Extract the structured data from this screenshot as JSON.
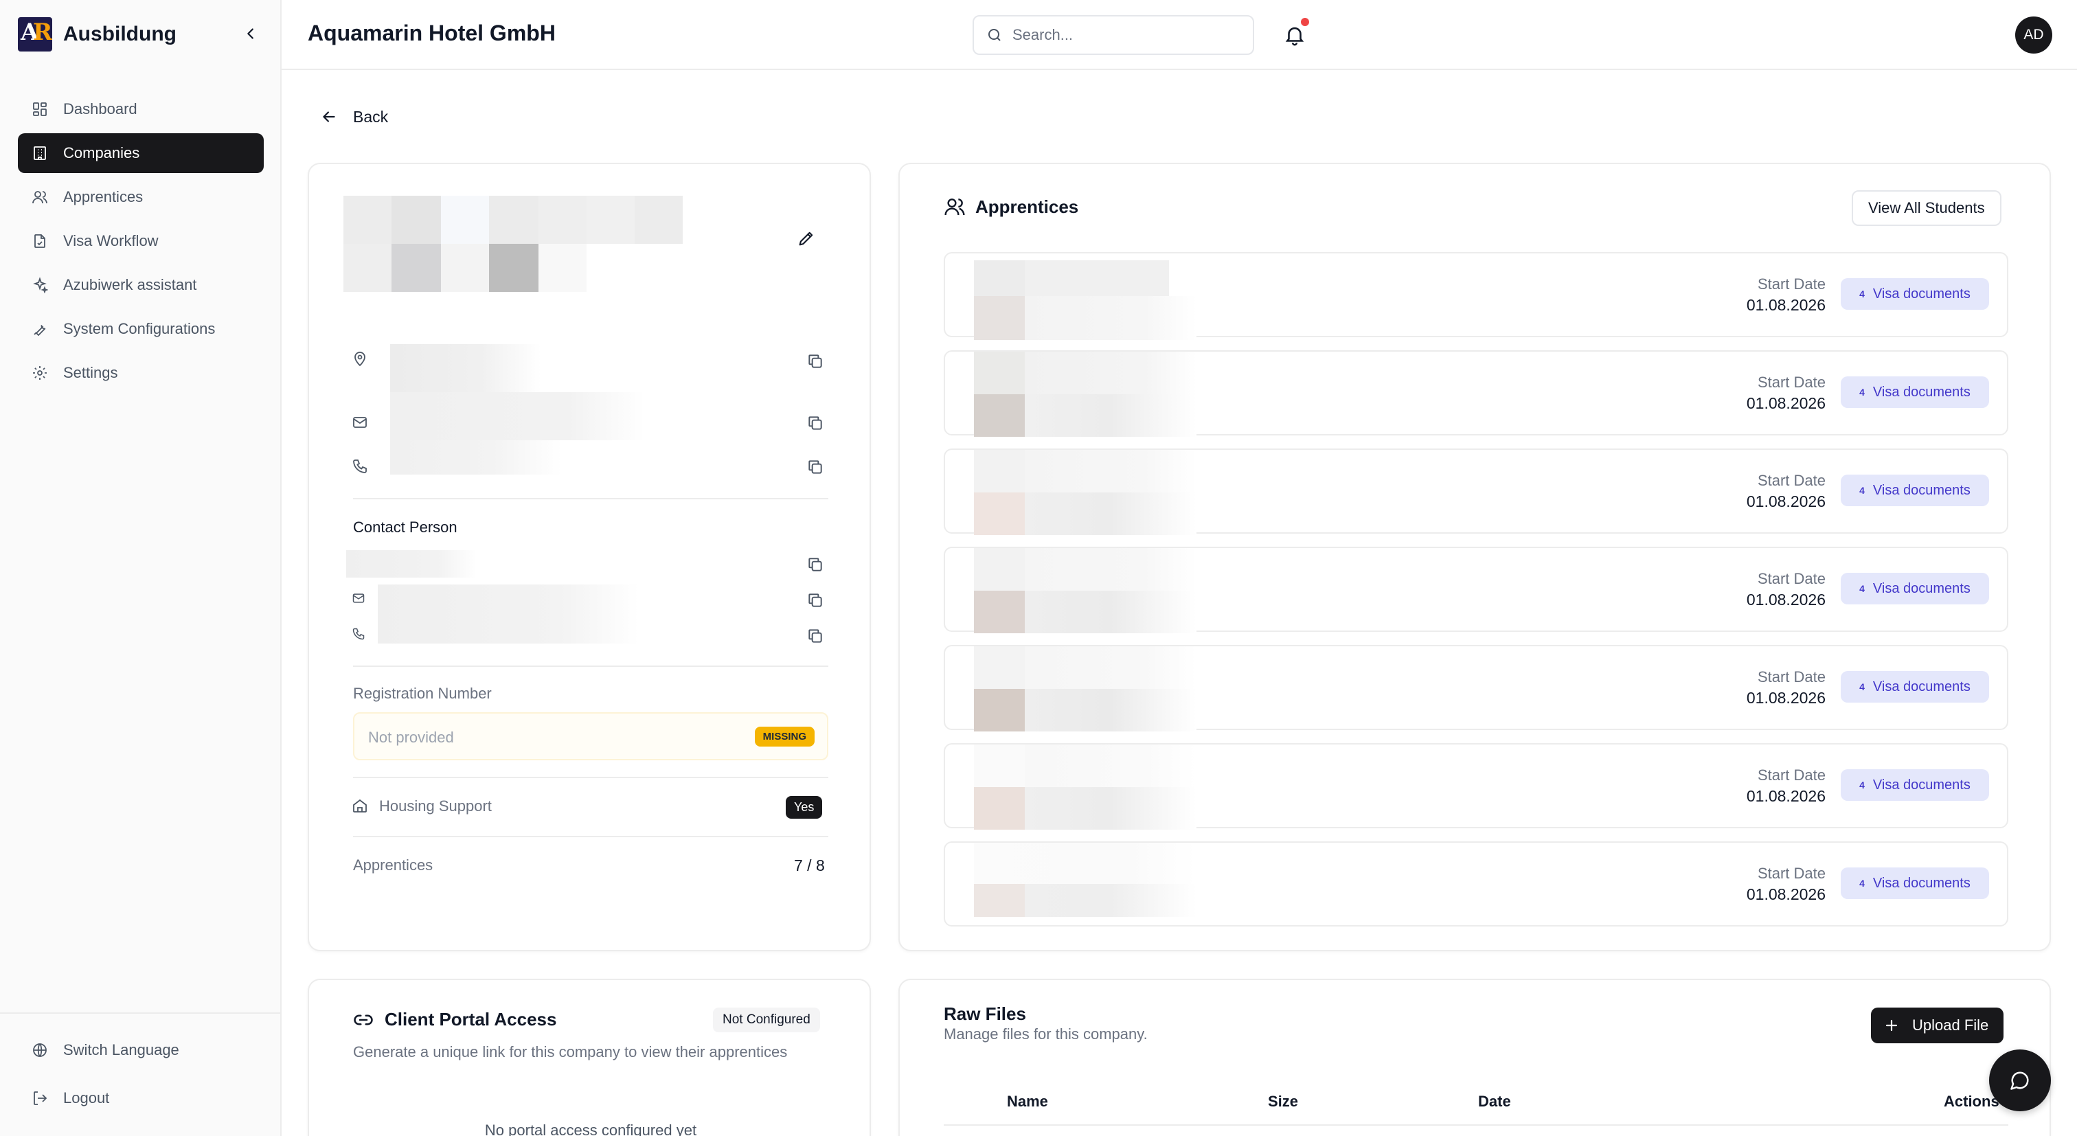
{
  "brand": {
    "title": "Ausbildung"
  },
  "sidebar": {
    "items": [
      {
        "label": "Dashboard",
        "icon": "dashboard-icon"
      },
      {
        "label": "Companies",
        "icon": "building-icon",
        "active": true
      },
      {
        "label": "Apprentices",
        "icon": "users-icon"
      },
      {
        "label": "Visa Workflow",
        "icon": "file-check-icon"
      },
      {
        "label": "Azubiwerk assistant",
        "icon": "sparkles-icon"
      },
      {
        "label": "System Configurations",
        "icon": "wrench-icon"
      },
      {
        "label": "Settings",
        "icon": "gear-icon"
      }
    ],
    "bottom": [
      {
        "label": "Switch Language",
        "icon": "globe-icon"
      },
      {
        "label": "Logout",
        "icon": "logout-icon"
      }
    ]
  },
  "header": {
    "title": "Aquamarin Hotel GmbH",
    "search_placeholder": "Search...",
    "avatar": "AD",
    "notification_color": "#ef4444"
  },
  "back_label": "Back",
  "company": {
    "contact_person_label": "Contact Person",
    "registration_label": "Registration Number",
    "registration_placeholder": "Not provided",
    "registration_status": "MISSING",
    "housing_label": "Housing Support",
    "housing_value": "Yes",
    "apprentices_label": "Apprentices",
    "apprentices_value": "7 / 8"
  },
  "apprentices": {
    "title": "Apprentices",
    "view_all_label": "View All Students",
    "rows": [
      {
        "start_label": "Start Date",
        "start_date": "01.08.2026",
        "visa_count": "4",
        "visa_label": "Visa documents"
      },
      {
        "start_label": "Start Date",
        "start_date": "01.08.2026",
        "visa_count": "4",
        "visa_label": "Visa documents"
      },
      {
        "start_label": "Start Date",
        "start_date": "01.08.2026",
        "visa_count": "4",
        "visa_label": "Visa documents"
      },
      {
        "start_label": "Start Date",
        "start_date": "01.08.2026",
        "visa_count": "4",
        "visa_label": "Visa documents"
      },
      {
        "start_label": "Start Date",
        "start_date": "01.08.2026",
        "visa_count": "4",
        "visa_label": "Visa documents"
      },
      {
        "start_label": "Start Date",
        "start_date": "01.08.2026",
        "visa_count": "4",
        "visa_label": "Visa documents"
      },
      {
        "start_label": "Start Date",
        "start_date": "01.08.2026",
        "visa_count": "4",
        "visa_label": "Visa documents"
      }
    ]
  },
  "portal": {
    "title": "Client Portal Access",
    "status": "Not Configured",
    "description": "Generate a unique link for this company to view their apprentices",
    "empty": "No portal access configured yet"
  },
  "files": {
    "title": "Raw Files",
    "subtitle": "Manage files for this company.",
    "upload_label": "Upload File",
    "columns": [
      "Name",
      "Size",
      "Date",
      "Actions"
    ]
  },
  "colors": {
    "primary": "#18181b",
    "accent": "#f59e0b",
    "visa_badge_bg": "#e4e7fb",
    "visa_badge_text": "#4338ca",
    "missing_badge": "#f5b400"
  }
}
